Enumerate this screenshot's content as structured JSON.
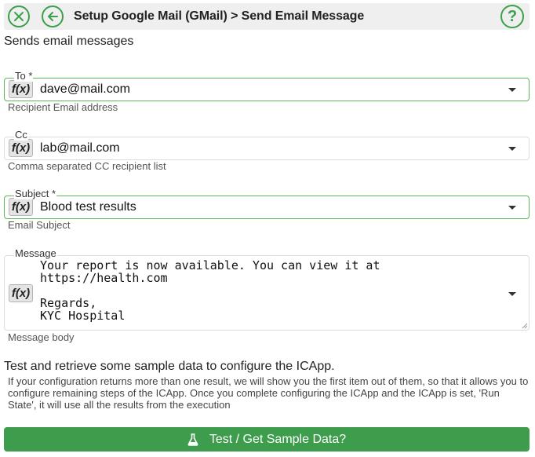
{
  "header": {
    "title": "Setup Google Mail (GMail) > Send Email Message",
    "help_glyph": "?"
  },
  "description": "Sends email messages",
  "fields": {
    "to": {
      "label": "To *",
      "fx": "f(x)",
      "value": "dave@mail.com",
      "help": "Recipient Email address"
    },
    "cc": {
      "label": "Cc",
      "fx": "f(x)",
      "value": "lab@mail.com",
      "help": "Comma separated CC recipient list"
    },
    "subject": {
      "label": "Subject *",
      "fx": "f(x)",
      "value": "Blood test results",
      "help": "Email Subject"
    },
    "message": {
      "label": "Message",
      "fx": "f(x)",
      "value": "Your report is now available. You can view it at\nhttps://health.com\n\nRegards,\nKYC Hospital",
      "help": "Message body"
    }
  },
  "test": {
    "title": "Test and retrieve some sample data to configure the ICApp.",
    "note": "If your configuration returns more than one result, we will show you the first item out of them, so that it allows you to configure remaining steps of the ICApp. Once you complete configuring the ICApp and the ICApp is set, 'Run State', it will use all the results from the execution",
    "button_label": "Test / Get Sample Data?"
  },
  "icons": {
    "close": "close-icon",
    "back": "back-arrow-icon",
    "help": "help-icon",
    "flask": "flask-icon"
  },
  "colors": {
    "accent": "#3d9d4d",
    "active_border": "#5cb85c",
    "header_bg": "#efefef"
  }
}
